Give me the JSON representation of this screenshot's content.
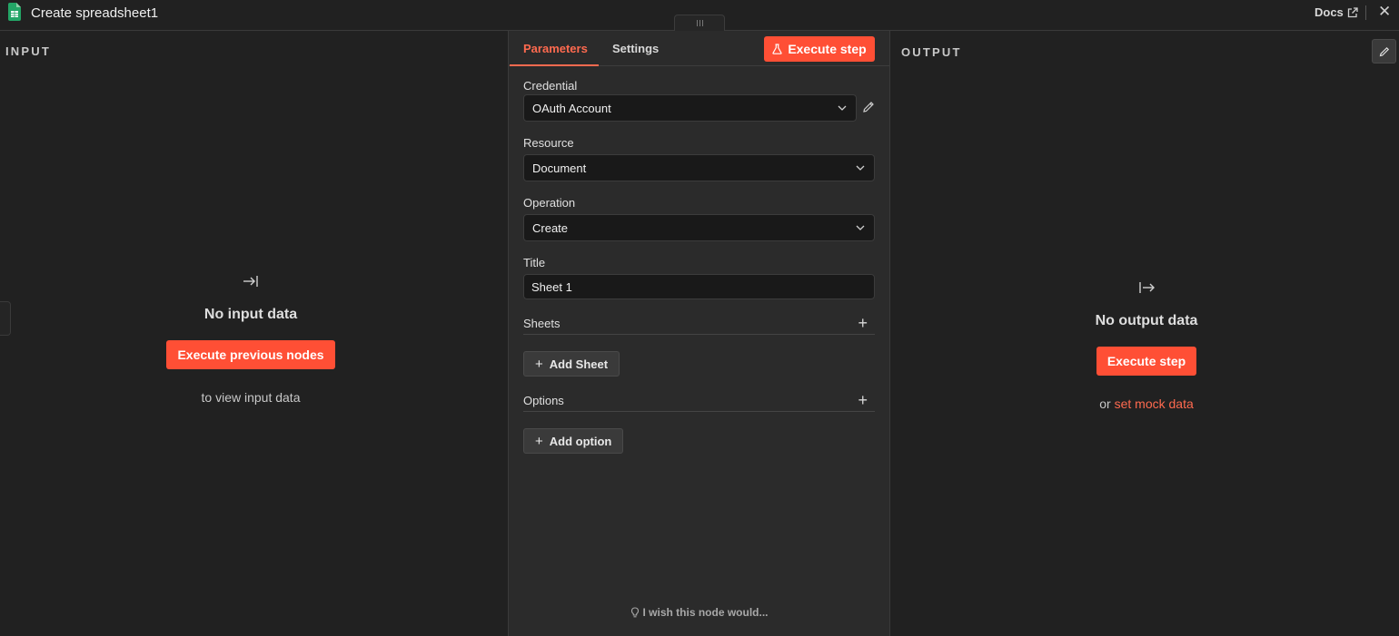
{
  "header": {
    "title": "Create spreadsheet1",
    "docs_label": "Docs",
    "close_label": "✕"
  },
  "input_panel": {
    "label": "INPUT",
    "empty_title": "No input data",
    "button_label": "Execute previous nodes",
    "sub_text": "to view input data"
  },
  "output_panel": {
    "label": "OUTPUT",
    "empty_title": "No output data",
    "button_label": "Execute step",
    "sub_prefix": "or",
    "mock_link": "set mock data"
  },
  "params": {
    "tabs": [
      "Parameters",
      "Settings"
    ],
    "active_tab": "Parameters",
    "execute_label": "Execute step",
    "credential": {
      "label": "Credential",
      "value": "OAuth Account"
    },
    "resource": {
      "label": "Resource",
      "value": "Document"
    },
    "operation": {
      "label": "Operation",
      "value": "Create"
    },
    "title": {
      "label": "Title",
      "value": "Sheet 1"
    },
    "sheets": {
      "label": "Sheets",
      "add_label": "Add Sheet"
    },
    "options": {
      "label": "Options",
      "add_label": "Add option"
    },
    "wish_label": "I wish this node would..."
  },
  "colors": {
    "accent": "#ff4f35",
    "link": "#ff6a4f",
    "sheets_icon": "#23a566"
  }
}
